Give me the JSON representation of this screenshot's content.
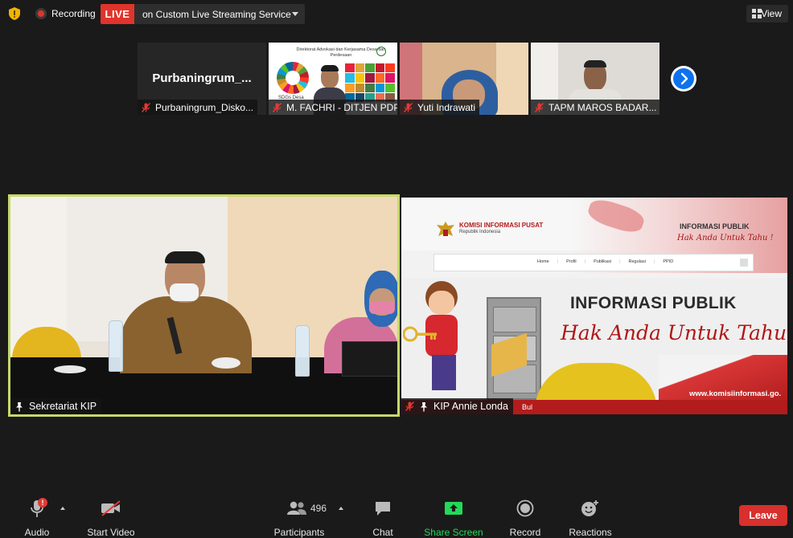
{
  "top_bar": {
    "recording_label": "Recording",
    "live_label": "LIVE",
    "live_destination": "on Custom Live Streaming Service",
    "view_label": "View",
    "security_icon": "shield-icon"
  },
  "thumbnails": [
    {
      "display_name": "Purbaningrum_...",
      "label": "Purbaningrum_Disko...",
      "muted": true
    },
    {
      "label": "M. FACHRI - DITJEN PDP",
      "muted": true,
      "slide_header": "Direktorat Advokasi dan Kerjasama Desa dan Perdesaan",
      "slide_caption": "SDGs Desa"
    },
    {
      "label": "Yuti Indrawati",
      "muted": true
    },
    {
      "label": "TAPM MAROS BADAR...",
      "muted": true
    }
  ],
  "main_videos": [
    {
      "label": "Sekretariat KIP",
      "speaking": true
    },
    {
      "label": "KIP Annie Londa",
      "muted": true,
      "slide": {
        "org_name": "KOMISI INFORMASI PUSAT",
        "org_sub": "Republik Indonesia",
        "header_right_title": "INFORMASI PUBLIK",
        "header_right_sub": "Hak Anda Untuk Tahu !",
        "nav": [
          "Home",
          "Profil",
          "Publikasi",
          "Regulasi",
          "PPID"
        ],
        "headline": "INFORMASI PUBLIK",
        "tagline": "Hak Anda Untuk Tahu !",
        "url": "www.komisiinformasi.go.",
        "partial_text": "Bul"
      }
    }
  ],
  "toolbar": {
    "audio_label": "Audio",
    "start_video_label": "Start Video",
    "participants_label": "Participants",
    "participants_count": "496",
    "chat_label": "Chat",
    "share_screen_label": "Share Screen",
    "record_label": "Record",
    "reactions_label": "Reactions",
    "leave_label": "Leave",
    "audio_alert": "!"
  },
  "colors": {
    "live_red": "#e0342b",
    "share_green": "#23d959",
    "active_speaker_border": "#c6d96b",
    "leave_red": "#d8302c",
    "nav_blue": "#0e72ed"
  }
}
